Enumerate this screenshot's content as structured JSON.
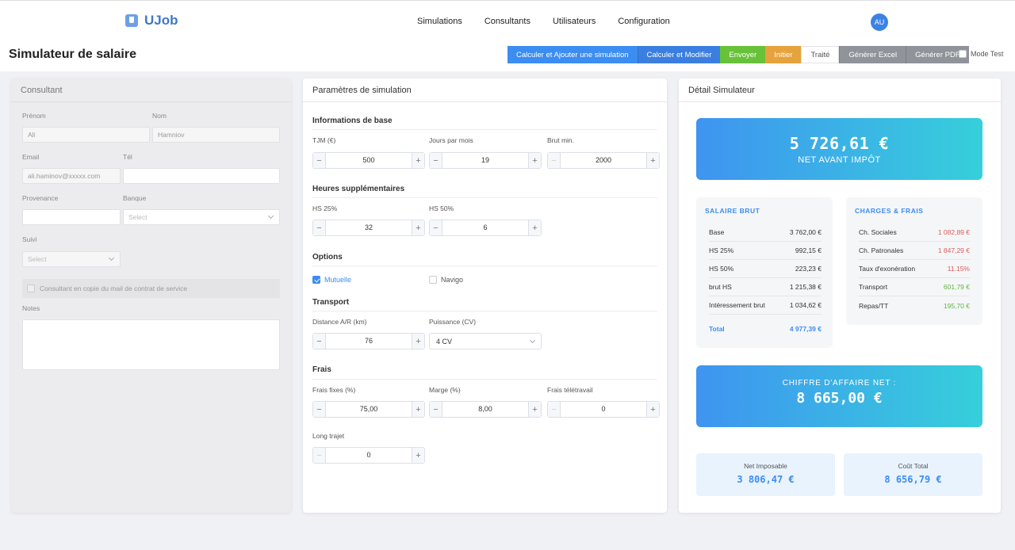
{
  "app": {
    "logo_text": "UJob",
    "avatar": "AU"
  },
  "nav": [
    "Simulations",
    "Consultants",
    "Utilisateurs",
    "Configuration"
  ],
  "page_title": "Simulateur de salaire",
  "toolbar": {
    "calc_add": "Calculer et Ajouter une simulation",
    "calc_modify": "Calculer et Modifier",
    "send": "Envoyer",
    "init": "Initier",
    "done": "Traité",
    "excel": "Générer Excel",
    "pdf": "Générer PDF",
    "mode_test": "Mode Test"
  },
  "consultant": {
    "title": "Consultant",
    "prenom_label": "Prénom",
    "prenom": "Ali",
    "nom_label": "Nom",
    "nom": "Hamniov",
    "email_label": "Email",
    "email": "ali.haminov@xxxxx.com",
    "tel_label": "Tél",
    "tel": "",
    "provenance_label": "Provenance",
    "provenance": "",
    "banque_label": "Banque",
    "banque_placeholder": "Select",
    "suivi_label": "Suivi",
    "suivi_placeholder": "Select",
    "copy_mail": "Consultant en copie du mail de contrat de service",
    "notes_label": "Notes"
  },
  "params": {
    "title": "Paramètres de simulation",
    "base_title": "Informations de base",
    "tjm_label": "TJM (€)",
    "tjm": "500",
    "jours_label": "Jours par mois",
    "jours": "19",
    "brut_label": "Brut min.",
    "brut": "2000",
    "hs_title": "Heures supplémentaires",
    "hs25_label": "HS 25%",
    "hs25": "32",
    "hs50_label": "HS 50%",
    "hs50": "6",
    "options_title": "Options",
    "mutuelle": "Mutuelle",
    "navigo": "Navigo",
    "transport_title": "Transport",
    "distance_label": "Distance A/R (km)",
    "distance": "76",
    "puissance_label": "Puissance (CV)",
    "puissance": "4 CV",
    "frais_title": "Frais",
    "frais_fixes_label": "Frais fixes (%)",
    "frais_fixes": "75,00",
    "marge_label": "Marge (%)",
    "marge": "8,00",
    "teletravail_label": "Frais télétravail",
    "teletravail": "0",
    "long_label": "Long trajet",
    "long": "0"
  },
  "detail": {
    "title": "Détail Simulateur",
    "net_value": "5 726,61 €",
    "net_label": "NET AVANT IMPÔT",
    "brut_title": "SALAIRE BRUT",
    "brut_rows": [
      {
        "label": "Base",
        "value": "3 762,00 €"
      },
      {
        "label": "HS 25%",
        "value": "992,15 €"
      },
      {
        "label": "HS 50%",
        "value": "223,23 €"
      },
      {
        "label": "brut HS",
        "value": "1 215,38 €"
      },
      {
        "label": "Intéressement brut",
        "value": "1 034,62 €"
      }
    ],
    "brut_total_label": "Total",
    "brut_total": "4 977,39 €",
    "charges_title": "CHARGES & FRAIS",
    "charges_rows": [
      {
        "label": "Ch. Sociales",
        "value": "1 082,89 €"
      },
      {
        "label": "Ch. Patronales",
        "value": "1 847,29 €"
      },
      {
        "label": "Taux d'exonération",
        "value": "11.15%"
      },
      {
        "label": "Transport",
        "value": "601,79 €"
      },
      {
        "label": "Repas/TT",
        "value": "195,70 €"
      }
    ],
    "ca_label": "CHIFFRE D'AFFAIRE NET :",
    "ca_value": "8 665,00 €",
    "imposable_label": "Net Imposable",
    "imposable": "3 806,47 €",
    "cout_label": "Coût Total",
    "cout": "8 656,79 €"
  }
}
